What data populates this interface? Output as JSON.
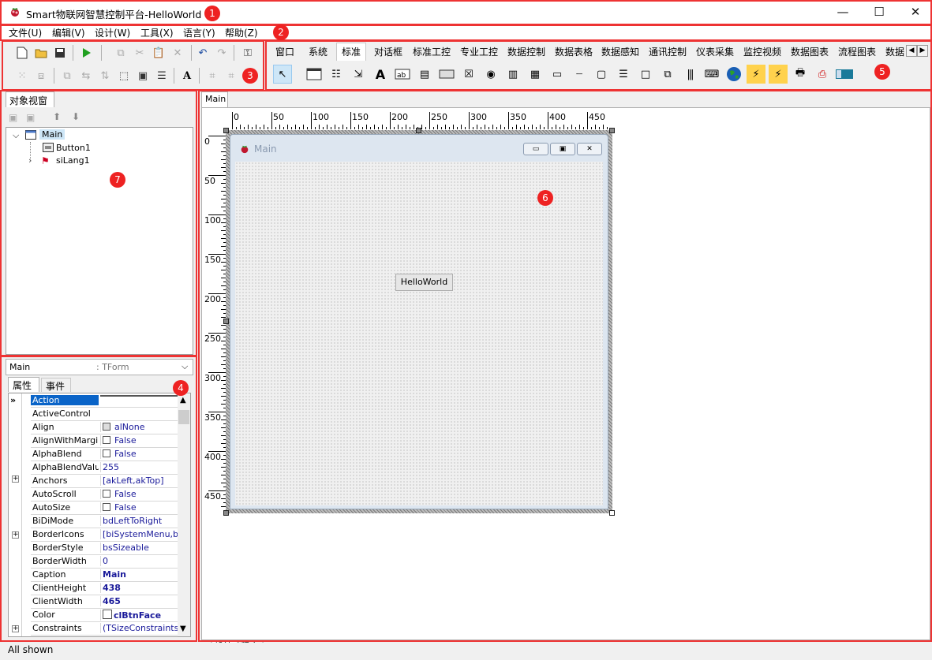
{
  "window": {
    "title": "Smart物联网智慧控制平台-HelloWorld",
    "minimize": "—",
    "maximize": "☐",
    "close": "✕"
  },
  "menu": [
    "文件(U)",
    "编辑(V)",
    "设计(W)",
    "工具(X)",
    "语言(Y)",
    "帮助(Z)"
  ],
  "palette_tabs": [
    "窗口",
    "系统",
    "标准",
    "对话框",
    "标准工控",
    "专业工控",
    "数据控制",
    "数据表格",
    "数据感知",
    "通讯控制",
    "仪表采集",
    "监控视频",
    "数据图表",
    "流程图表",
    "数据"
  ],
  "palette_active": "标准",
  "object_view": {
    "title": "对象视窗",
    "tree": [
      {
        "label": "Main"
      },
      {
        "label": "Button1"
      },
      {
        "label": "siLang1"
      }
    ]
  },
  "inspector": {
    "selected": "Main",
    "selected_type": ": TForm",
    "tabs": [
      "属性",
      "事件"
    ],
    "props": [
      {
        "n": "Action",
        "v": ""
      },
      {
        "n": "ActiveControl",
        "v": ""
      },
      {
        "n": "Align",
        "v": "alNone"
      },
      {
        "n": "AlignWithMargins",
        "v": "False"
      },
      {
        "n": "AlphaBlend",
        "v": "False"
      },
      {
        "n": "AlphaBlendValue",
        "v": "255"
      },
      {
        "n": "Anchors",
        "v": "[akLeft,akTop]"
      },
      {
        "n": "AutoScroll",
        "v": "False"
      },
      {
        "n": "AutoSize",
        "v": "False"
      },
      {
        "n": "BiDiMode",
        "v": "bdLeftToRight"
      },
      {
        "n": "BorderIcons",
        "v": "[biSystemMenu,biMinin"
      },
      {
        "n": "BorderStyle",
        "v": "bsSizeable"
      },
      {
        "n": "BorderWidth",
        "v": "0"
      },
      {
        "n": "Caption",
        "v": "Main"
      },
      {
        "n": "ClientHeight",
        "v": "438"
      },
      {
        "n": "ClientWidth",
        "v": "465"
      },
      {
        "n": "Color",
        "v": "clBtnFace"
      },
      {
        "n": "Constraints",
        "v": "(TSizeConstraints)"
      }
    ]
  },
  "designer": {
    "tab": "Main",
    "form_caption": "Main",
    "button_label": "HelloWorld",
    "ruler_h": [
      "0",
      "50",
      "100",
      "150",
      "200",
      "250",
      "300",
      "350",
      "400",
      "450"
    ],
    "ruler_v": [
      "0",
      "50",
      "100",
      "150",
      "200",
      "250",
      "300",
      "350",
      "400",
      "450"
    ],
    "bottom_tabs": [
      "设计",
      "程序"
    ]
  },
  "status": {
    "text": "All shown"
  },
  "badges": [
    "1",
    "2",
    "3",
    "4",
    "5",
    "6",
    "7"
  ],
  "colors": {
    "highlight": "#0a64c8",
    "annotation": "#e22222",
    "accent_run": "#20a020"
  }
}
